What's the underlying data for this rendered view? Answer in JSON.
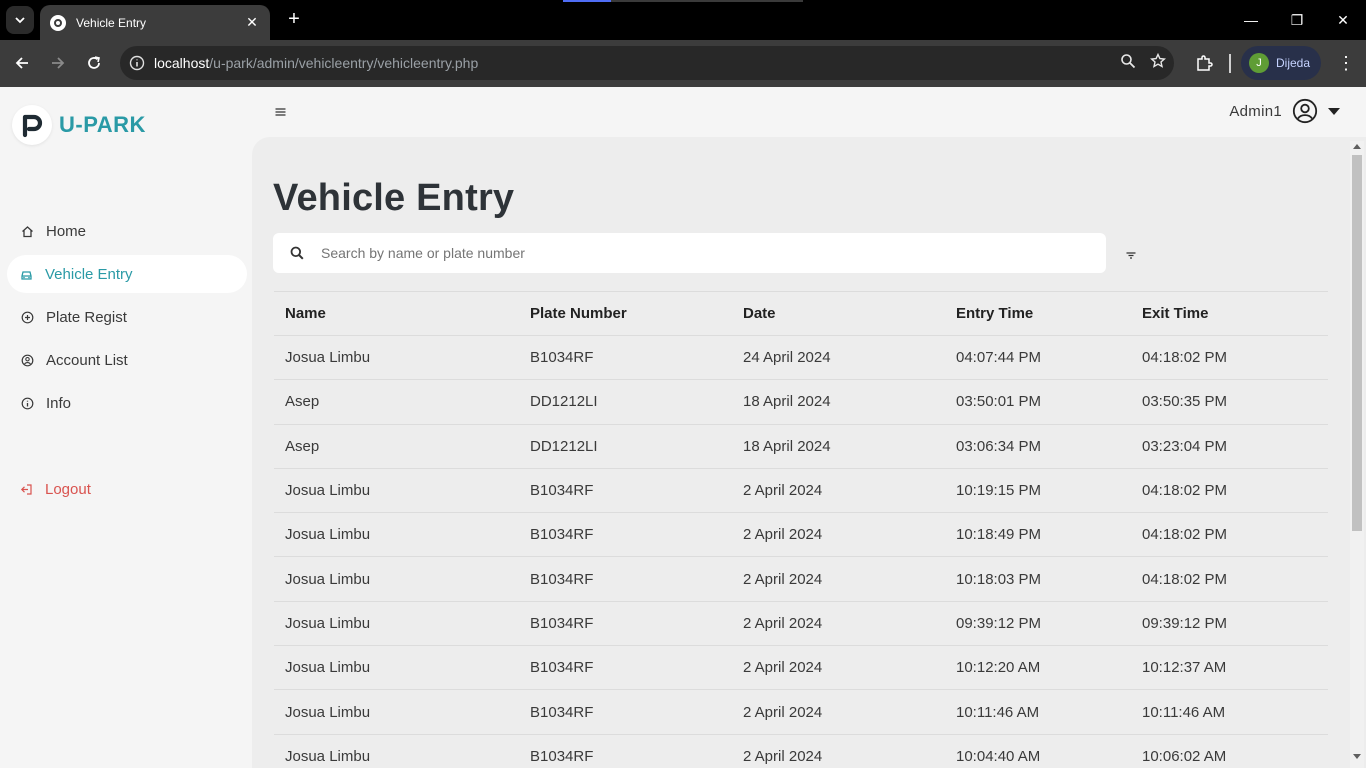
{
  "browser": {
    "tab_title": "Vehicle Entry",
    "url_host": "localhost",
    "url_path": "/u-park/admin/vehicleentry/vehicleentry.php",
    "profile_initial": "J",
    "profile_name": "Dijeda"
  },
  "sidebar": {
    "logo_text": "U-PARK",
    "items": [
      {
        "label": "Home",
        "icon": "home-icon"
      },
      {
        "label": "Vehicle Entry",
        "icon": "car-icon"
      },
      {
        "label": "Plate Regist",
        "icon": "plus-circle-icon"
      },
      {
        "label": "Account List",
        "icon": "user-circle-icon"
      },
      {
        "label": "Info",
        "icon": "info-icon"
      }
    ],
    "logout_label": "Logout"
  },
  "header": {
    "user_name": "Admin1"
  },
  "main": {
    "title": "Vehicle Entry",
    "search_placeholder": "Search by name or plate number",
    "table": {
      "headers": [
        "Name",
        "Plate Number",
        "Date",
        "Entry Time",
        "Exit Time"
      ],
      "rows": [
        [
          "Josua Limbu",
          "B1034RF",
          "24 April 2024",
          "04:07:44 PM",
          "04:18:02 PM"
        ],
        [
          "Asep",
          "DD1212LI",
          "18 April 2024",
          "03:50:01 PM",
          "03:50:35 PM"
        ],
        [
          "Asep",
          "DD1212LI",
          "18 April 2024",
          "03:06:34 PM",
          "03:23:04 PM"
        ],
        [
          "Josua Limbu",
          "B1034RF",
          "2 April 2024",
          "10:19:15 PM",
          "04:18:02 PM"
        ],
        [
          "Josua Limbu",
          "B1034RF",
          "2 April 2024",
          "10:18:49 PM",
          "04:18:02 PM"
        ],
        [
          "Josua Limbu",
          "B1034RF",
          "2 April 2024",
          "10:18:03 PM",
          "04:18:02 PM"
        ],
        [
          "Josua Limbu",
          "B1034RF",
          "2 April 2024",
          "09:39:12 PM",
          "09:39:12 PM"
        ],
        [
          "Josua Limbu",
          "B1034RF",
          "2 April 2024",
          "10:12:20 AM",
          "10:12:37 AM"
        ],
        [
          "Josua Limbu",
          "B1034RF",
          "2 April 2024",
          "10:11:46 AM",
          "10:11:46 AM"
        ],
        [
          "Josua Limbu",
          "B1034RF",
          "2 April 2024",
          "10:04:40 AM",
          "10:06:02 AM"
        ]
      ]
    }
  },
  "colors": {
    "accent": "#2a9aa6",
    "logout": "#d9534f",
    "sidebar_bg": "#f5f5f5",
    "content_bg": "#ededed"
  }
}
